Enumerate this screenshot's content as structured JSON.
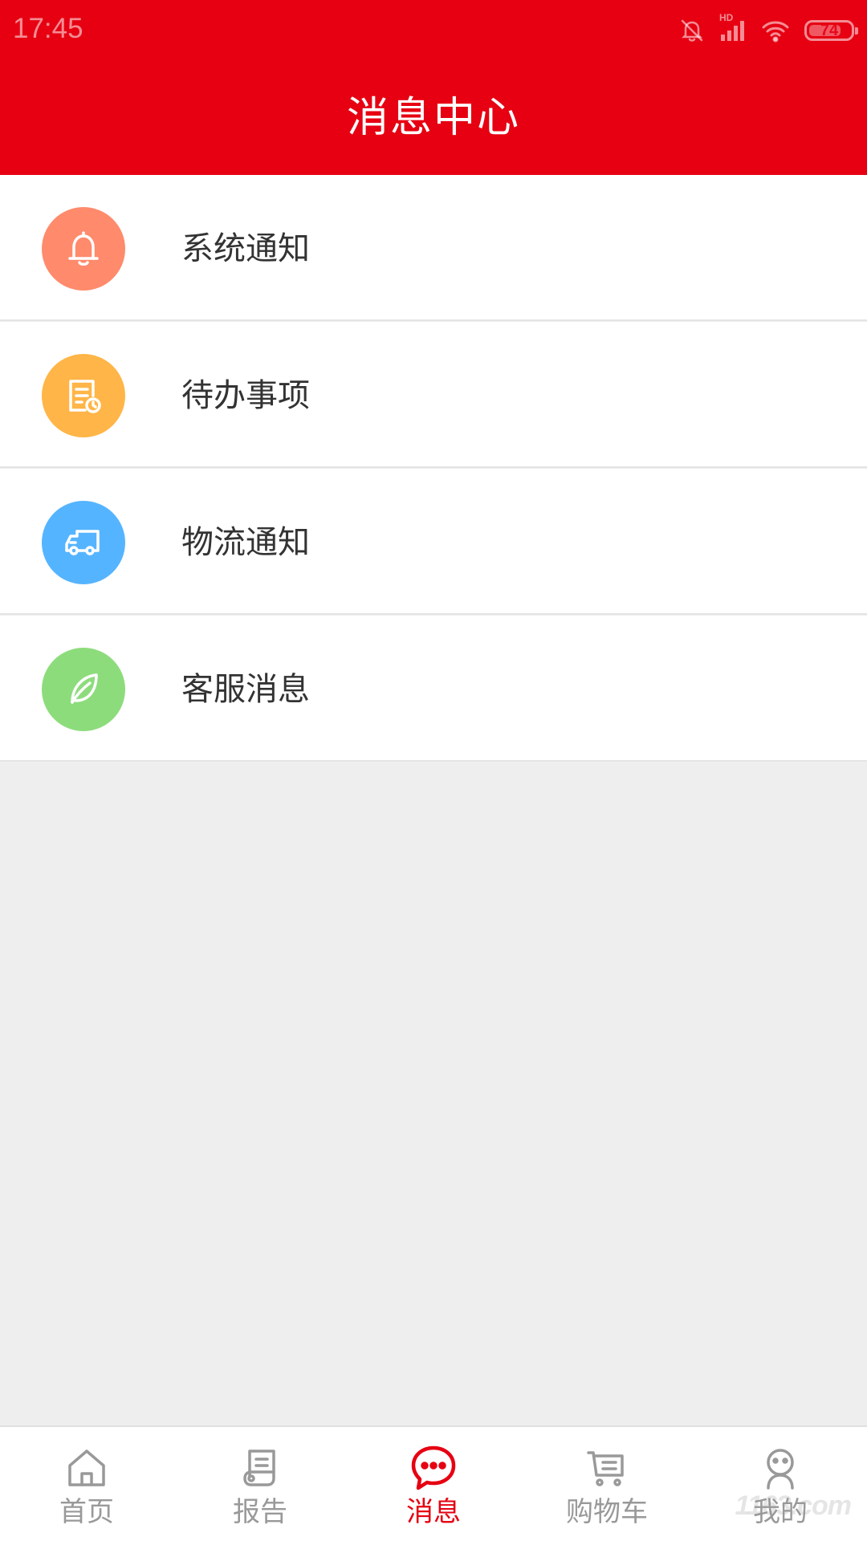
{
  "status_bar": {
    "time": "17:45",
    "battery_level": "74",
    "network": "HD"
  },
  "header": {
    "title": "消息中心",
    "background_color": "#e60012"
  },
  "messages": [
    {
      "label": "系统通知",
      "icon": "bell-icon",
      "color": "#ff8a6c"
    },
    {
      "label": "待办事项",
      "icon": "todo-icon",
      "color": "#ffb547"
    },
    {
      "label": "物流通知",
      "icon": "truck-icon",
      "color": "#55b4ff"
    },
    {
      "label": "客服消息",
      "icon": "leaf-icon",
      "color": "#8ddc7c"
    }
  ],
  "tabbar": {
    "active_color": "#e60012",
    "inactive_color": "#999999",
    "tabs": [
      {
        "label": "首页",
        "icon": "home-icon",
        "active": false
      },
      {
        "label": "报告",
        "icon": "report-icon",
        "active": false
      },
      {
        "label": "消息",
        "icon": "message-icon",
        "active": true
      },
      {
        "label": "购物车",
        "icon": "cart-icon",
        "active": false
      },
      {
        "label": "我的",
        "icon": "profile-icon",
        "active": false
      }
    ]
  }
}
